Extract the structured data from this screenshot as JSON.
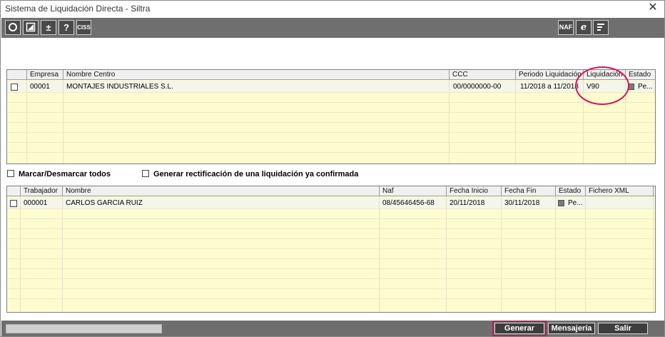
{
  "window": {
    "title": "Sistema de Liquidación Directa - Siltra",
    "close_glyph": "✕"
  },
  "toolbar": {
    "left": [
      {
        "name": "refresh-icon",
        "glyph": ""
      },
      {
        "name": "edit-icon",
        "glyph": ""
      },
      {
        "name": "plus-minus-icon",
        "glyph": "±"
      },
      {
        "name": "help-icon",
        "glyph": "?"
      },
      {
        "name": "ciss-button",
        "glyph": "CISS"
      }
    ],
    "right": [
      {
        "name": "naf-button",
        "glyph": "NAF"
      },
      {
        "name": "ie-icon",
        "glyph": "e"
      },
      {
        "name": "report-icon",
        "glyph": ""
      }
    ]
  },
  "liquidaciones": {
    "columns": [
      "",
      "Empresa",
      "Nombre Centro",
      "CCC",
      "Periodo Liquidación",
      "Liquidación",
      "Estado"
    ],
    "rows": [
      {
        "empresa": "00001",
        "nombre_centro": "MONTAJES INDUSTRIALES S.L.",
        "ccc": "00/0000000-00",
        "periodo": "11/2018 a 11/2018",
        "liquidacion": "V90",
        "estado": "Pe..."
      }
    ]
  },
  "options": {
    "marcar_todos": "Marcar/Desmarcar todos",
    "rectificacion": "Generar rectificación de una liquidación ya confirmada"
  },
  "trabajadores": {
    "columns": [
      "",
      "Trabajador",
      "Nombre",
      "Naf",
      "Fecha Inicio",
      "Fecha Fin",
      "Estado",
      "Fichero XML"
    ],
    "rows": [
      {
        "trabajador": "000001",
        "nombre": "CARLOS GARCIA RUIZ",
        "naf": "08/45646456-68",
        "fecha_inicio": "20/11/2018",
        "fecha_fin": "30/11/2018",
        "estado": "Pe...",
        "fichero": ""
      }
    ]
  },
  "footer": {
    "generar": "Generar",
    "mensajeria": "Mensajería",
    "salir": "Salir"
  },
  "colors": {
    "grid_bg": "#fefccf",
    "toolbar": "#6f6f6f",
    "annotation": "#d4145a"
  }
}
